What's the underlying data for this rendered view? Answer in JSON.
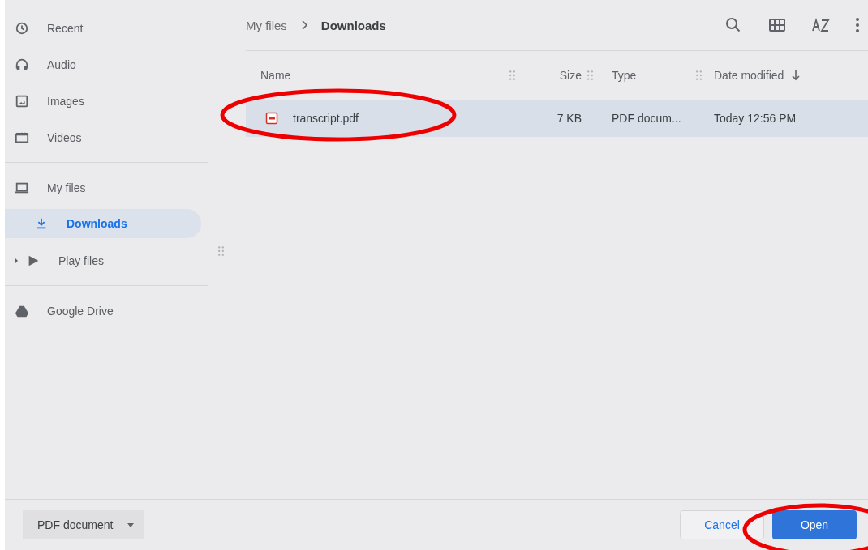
{
  "sidebar": {
    "sections": [
      {
        "items": [
          {
            "label": "Recent",
            "selected": false,
            "indent": false
          },
          {
            "label": "Audio",
            "selected": false,
            "indent": false
          },
          {
            "label": "Images",
            "selected": false,
            "indent": false
          },
          {
            "label": "Videos",
            "selected": false,
            "indent": false
          }
        ]
      },
      {
        "items": [
          {
            "label": "My files",
            "selected": false,
            "indent": false
          },
          {
            "label": "Downloads",
            "selected": true,
            "indent": true
          },
          {
            "label": "Play files",
            "selected": false,
            "indent": true,
            "expandable": true
          }
        ]
      },
      {
        "items": [
          {
            "label": "Google Drive",
            "selected": false,
            "indent": false
          }
        ]
      }
    ]
  },
  "breadcrumb": [
    "My files",
    "Downloads"
  ],
  "table": {
    "columns": [
      {
        "label": "Name",
        "sorted": false
      },
      {
        "label": "Size",
        "sorted": false
      },
      {
        "label": "Type",
        "sorted": false
      },
      {
        "label": "Date modified",
        "sorted": true
      }
    ],
    "rows": [
      {
        "name": "transcript.pdf",
        "size": "7 KB",
        "type": "PDF docum...",
        "date": "Today 12:56 PM",
        "selected": true
      }
    ]
  },
  "footer": {
    "filter": "PDF document",
    "cancel": "Cancel",
    "open": "Open"
  }
}
